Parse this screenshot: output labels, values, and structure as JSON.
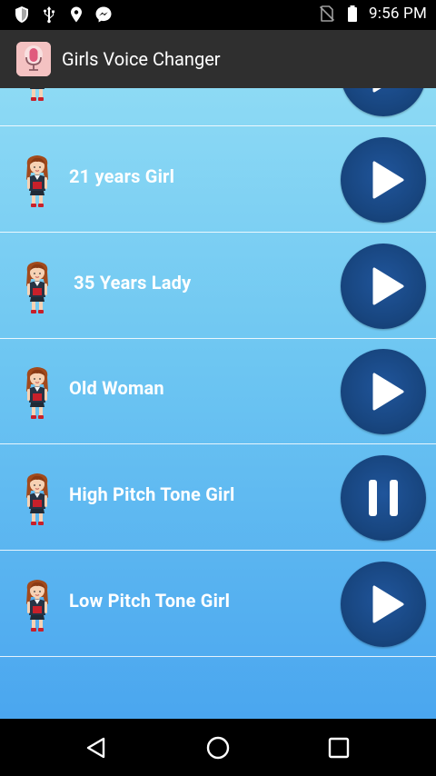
{
  "status_bar": {
    "time": "9:56 PM",
    "left_icons": [
      "shield-icon",
      "usb-icon",
      "location-pin-icon",
      "messenger-icon"
    ],
    "right_icons": [
      "no-sim-icon",
      "battery-icon"
    ]
  },
  "app_bar": {
    "title": "Girls Voice Changer",
    "icon": "microphone-app-icon"
  },
  "voices": [
    {
      "label": "",
      "state": "play"
    },
    {
      "label": "21 years Girl",
      "state": "play"
    },
    {
      "label": " 35 Years Lady",
      "state": "play"
    },
    {
      "label": "Old Woman",
      "state": "play"
    },
    {
      "label": "High Pitch Tone Girl",
      "state": "pause"
    },
    {
      "label": "Low Pitch Tone Girl",
      "state": "play"
    }
  ],
  "nav_bar": {
    "buttons": [
      "back-icon",
      "home-icon",
      "recents-icon"
    ]
  },
  "colors": {
    "list_gradient_top": "#8ddaf4",
    "list_gradient_bottom": "#4aa6ef",
    "button": "#184680",
    "app_bar": "#2f2f2f"
  }
}
